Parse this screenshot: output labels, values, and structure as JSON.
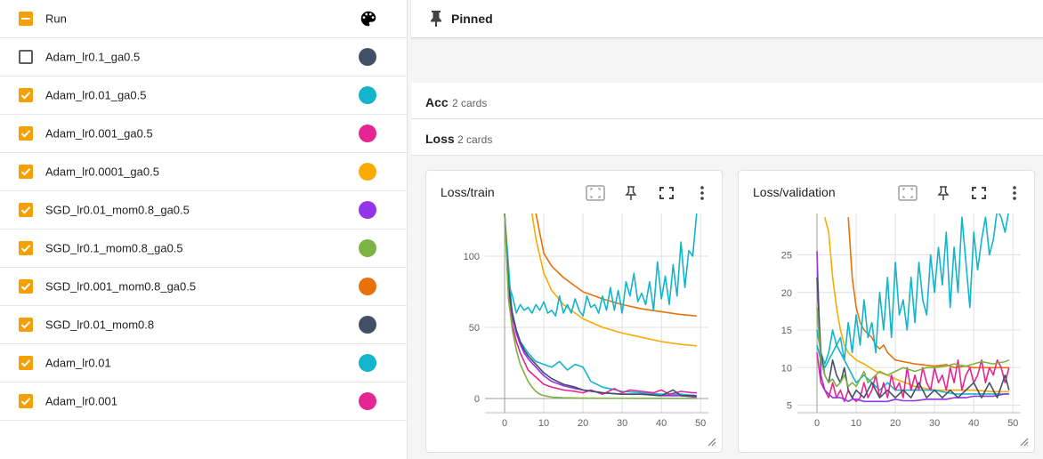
{
  "runs_header": {
    "label": "Run",
    "palette_icon": "palette-icon"
  },
  "runs": [
    {
      "name": "Adam_lr0.1_ga0.5",
      "checked": false,
      "color": "#425066"
    },
    {
      "name": "Adam_lr0.01_ga0.5",
      "checked": true,
      "color": "#12b5cb"
    },
    {
      "name": "Adam_lr0.001_ga0.5",
      "checked": true,
      "color": "#e52592"
    },
    {
      "name": "Adam_lr0.0001_ga0.5",
      "checked": true,
      "color": "#f9ab00"
    },
    {
      "name": "SGD_lr0.01_mom0.8_ga0.5",
      "checked": true,
      "color": "#9334e6"
    },
    {
      "name": "SGD_lr0.1_mom0.8_ga0.5",
      "checked": true,
      "color": "#7cb342"
    },
    {
      "name": "SGD_lr0.001_mom0.8_ga0.5",
      "checked": true,
      "color": "#e8710a"
    },
    {
      "name": "SGD_lr0.01_mom0.8",
      "checked": true,
      "color": "#425066"
    },
    {
      "name": "Adam_lr0.01",
      "checked": true,
      "color": "#12b5cb"
    },
    {
      "name": "Adam_lr0.001",
      "checked": true,
      "color": "#e52592"
    }
  ],
  "pinned": {
    "label": "Pinned",
    "icon": "pin-icon"
  },
  "groups": [
    {
      "title": "Acc",
      "count": "2 cards"
    },
    {
      "title": "Loss",
      "count": "2 cards"
    }
  ],
  "cards": {
    "train": {
      "title": "Loss/train"
    },
    "validation": {
      "title": "Loss/validation"
    }
  },
  "card_buttons": [
    "fit-domain-icon",
    "pin-icon",
    "fullscreen-icon",
    "more-vert-icon"
  ],
  "chart_data": [
    {
      "type": "line",
      "title": "Loss/train",
      "xlabel": "",
      "ylabel": "",
      "xlim": [
        -5,
        52
      ],
      "ylim": [
        -10,
        130
      ],
      "x_ticks": [
        0,
        10,
        20,
        30,
        40,
        50
      ],
      "y_ticks": [
        0,
        50,
        100
      ],
      "grid": true,
      "series": [
        {
          "color": "#e8710a",
          "x": [
            8,
            10,
            12,
            15,
            18,
            20,
            25,
            30,
            35,
            40,
            45,
            49
          ],
          "y": [
            130,
            102,
            93,
            85,
            79,
            75,
            70,
            66,
            63,
            61,
            59,
            58
          ]
        },
        {
          "color": "#f9ab00",
          "x": [
            7,
            8,
            10,
            12,
            15,
            18,
            20,
            25,
            30,
            35,
            40,
            45,
            49
          ],
          "y": [
            130,
            112,
            88,
            76,
            66,
            60,
            56,
            50,
            46,
            43,
            40,
            38,
            37
          ]
        },
        {
          "color": "#12b5cb",
          "x": [
            0,
            1,
            2,
            3,
            4,
            5,
            6,
            7,
            8,
            9,
            10,
            11,
            12,
            13,
            14,
            15,
            16,
            17,
            18,
            19,
            20,
            21,
            22,
            23,
            24,
            25,
            26,
            27,
            28,
            29,
            30,
            31,
            32,
            33,
            34,
            35,
            36,
            37,
            38,
            39,
            40,
            41,
            42,
            43,
            44,
            45,
            46,
            47,
            48,
            49
          ],
          "y": [
            130,
            80,
            72,
            60,
            66,
            62,
            64,
            60,
            66,
            62,
            68,
            60,
            62,
            58,
            72,
            60,
            66,
            60,
            70,
            62,
            58,
            72,
            64,
            66,
            60,
            72,
            62,
            78,
            62,
            76,
            60,
            82,
            72,
            88,
            68,
            74,
            66,
            82,
            62,
            96,
            70,
            86,
            66,
            94,
            72,
            110,
            78,
            104,
            100,
            130
          ]
        },
        {
          "color": "#12b5cb",
          "x": [
            0,
            2,
            4,
            6,
            8,
            10,
            12,
            14,
            16,
            18,
            20,
            22,
            25,
            30,
            35,
            40,
            45,
            49
          ],
          "y": [
            130,
            56,
            40,
            32,
            26,
            24,
            22,
            26,
            20,
            24,
            22,
            12,
            8,
            5,
            4,
            3,
            3,
            2
          ]
        },
        {
          "color": "#e52592",
          "x": [
            0,
            1,
            2,
            3,
            4,
            5,
            6,
            8,
            10,
            12,
            15,
            18,
            20,
            22,
            25,
            28,
            30,
            32,
            35,
            38,
            40,
            42,
            45,
            48,
            49
          ],
          "y": [
            130,
            75,
            52,
            40,
            32,
            26,
            20,
            15,
            10,
            8,
            6,
            5,
            4,
            6,
            3,
            7,
            4,
            6,
            5,
            4,
            6,
            3,
            5,
            4,
            4
          ]
        },
        {
          "color": "#9334e6",
          "x": [
            0,
            1,
            2,
            3,
            4,
            5,
            6,
            8,
            10,
            12,
            15,
            18,
            20,
            25,
            30,
            35,
            40,
            45,
            49
          ],
          "y": [
            130,
            80,
            58,
            46,
            38,
            32,
            28,
            22,
            16,
            12,
            9,
            7,
            6,
            4,
            3,
            3,
            2,
            2,
            1
          ]
        },
        {
          "color": "#425066",
          "x": [
            0,
            1,
            2,
            3,
            4,
            5,
            6,
            8,
            10,
            12,
            15,
            18,
            20,
            25,
            30,
            35,
            40,
            43,
            45,
            49
          ],
          "y": [
            130,
            78,
            60,
            48,
            40,
            34,
            30,
            24,
            18,
            14,
            10,
            8,
            6,
            4,
            3,
            3,
            2,
            6,
            2,
            2
          ]
        },
        {
          "color": "#7cb342",
          "x": [
            0,
            1,
            2,
            3,
            4,
            5,
            6,
            7,
            8,
            9,
            10,
            12,
            15,
            20,
            25,
            30,
            35,
            40,
            45,
            49
          ],
          "y": [
            130,
            70,
            48,
            34,
            24,
            18,
            12,
            8,
            5,
            3,
            2,
            1,
            0.5,
            0.3,
            0.2,
            0.2,
            0.1,
            0.1,
            0.1,
            0.1
          ]
        }
      ]
    },
    {
      "type": "line",
      "title": "Loss/validation",
      "xlabel": "",
      "ylabel": "",
      "xlim": [
        -5,
        52
      ],
      "ylim": [
        4,
        30.5
      ],
      "x_ticks": [
        0,
        10,
        20,
        30,
        40,
        50
      ],
      "y_ticks": [
        5,
        10,
        15,
        20,
        25
      ],
      "grid": true,
      "series": [
        {
          "color": "#e8710a",
          "x": [
            8,
            9,
            10,
            11,
            12,
            13,
            14,
            15,
            16,
            17,
            18,
            19,
            20,
            22,
            25,
            28,
            30,
            33,
            35,
            38,
            40,
            45,
            49
          ],
          "y": [
            30,
            22,
            18,
            16,
            15,
            14.5,
            14,
            13,
            12.5,
            13,
            12,
            11.5,
            11,
            10.8,
            10.5,
            10.3,
            10.2,
            10.4,
            10,
            10.2,
            10,
            10,
            10
          ]
        },
        {
          "color": "#f9ab00",
          "x": [
            2,
            3,
            4,
            5,
            6,
            7,
            8,
            9,
            10,
            12,
            15,
            18,
            20,
            25,
            30,
            35,
            40,
            45,
            49
          ],
          "y": [
            30,
            28,
            22,
            18,
            15,
            13,
            12,
            11.5,
            11,
            10.5,
            9.5,
            9,
            8.5,
            7.5,
            7,
            7,
            7,
            6.8,
            6.8
          ]
        },
        {
          "color": "#12b5cb",
          "x": [
            0,
            1,
            2,
            3,
            4,
            5,
            6,
            7,
            8,
            9,
            10,
            11,
            12,
            13,
            14,
            15,
            16,
            17,
            18,
            19,
            20,
            21,
            22,
            23,
            24,
            25,
            26,
            27,
            28,
            29,
            30,
            31,
            32,
            33,
            34,
            35,
            36,
            37,
            38,
            39,
            40,
            41,
            42,
            43,
            44,
            45,
            46,
            47,
            48,
            49
          ],
          "y": [
            15,
            12,
            10.5,
            12,
            15,
            13,
            14,
            11,
            16,
            12,
            17,
            13,
            19,
            14,
            16,
            12,
            20,
            15,
            22,
            14,
            24,
            17,
            19,
            15,
            22,
            16,
            24,
            19,
            17,
            25,
            20,
            26,
            21,
            28,
            18,
            26,
            20,
            30,
            24,
            18,
            28,
            23,
            27,
            30,
            25,
            27,
            31,
            30,
            28,
            31
          ]
        },
        {
          "color": "#12b5cb",
          "x": [
            0,
            1,
            2,
            3,
            4,
            5,
            6,
            7,
            8,
            9,
            10,
            12,
            14,
            16,
            18,
            20,
            25,
            30,
            35,
            40,
            45,
            49
          ],
          "y": [
            13,
            11,
            10,
            11,
            12,
            13,
            12,
            11,
            10,
            9,
            8,
            9,
            8,
            7,
            8,
            7,
            7,
            7,
            6.5,
            6.5,
            6.5,
            6.5
          ]
        },
        {
          "color": "#e52592",
          "x": [
            0,
            1,
            2,
            3,
            4,
            5,
            6,
            7,
            8,
            9,
            10,
            11,
            12,
            13,
            14,
            15,
            16,
            17,
            18,
            19,
            20,
            21,
            22,
            23,
            24,
            25,
            26,
            27,
            28,
            29,
            30,
            31,
            32,
            33,
            34,
            35,
            36,
            37,
            38,
            39,
            40,
            41,
            42,
            43,
            44,
            45,
            46,
            47,
            48,
            49
          ],
          "y": [
            12,
            8,
            7,
            6,
            8,
            6,
            7,
            5.5,
            7,
            6,
            5.5,
            6,
            8,
            6,
            7,
            9,
            6,
            8,
            6,
            9,
            7,
            8,
            6,
            10,
            7,
            9,
            7,
            10,
            8,
            7,
            10,
            8,
            9,
            7,
            10,
            8,
            11,
            7,
            9,
            10,
            8,
            9,
            11,
            8,
            10,
            9,
            11,
            10,
            8,
            10
          ]
        },
        {
          "color": "#9334e6",
          "x": [
            0,
            1,
            2,
            3,
            4,
            5,
            6,
            7,
            8,
            9,
            10,
            12,
            15,
            18,
            20,
            22,
            25,
            28,
            30,
            33,
            35,
            38,
            40,
            42,
            45,
            48,
            49
          ],
          "y": [
            25.5,
            9,
            7,
            6.5,
            6,
            6,
            6,
            5.8,
            5.5,
            5.8,
            5.8,
            5.5,
            5.5,
            5.5,
            5.8,
            5.6,
            5.6,
            5.8,
            5.8,
            5.8,
            6,
            6,
            6.2,
            6.2,
            6.2,
            6.5,
            6.5
          ]
        },
        {
          "color": "#425066",
          "x": [
            0,
            1,
            2,
            3,
            4,
            5,
            6,
            7,
            8,
            9,
            10,
            12,
            14,
            16,
            18,
            20,
            22,
            24,
            26,
            28,
            30,
            32,
            34,
            36,
            38,
            40,
            42,
            44,
            46,
            48,
            49
          ],
          "y": [
            22,
            12,
            9,
            8,
            11,
            9,
            8,
            10,
            7,
            6,
            7,
            6,
            8,
            6,
            7,
            6,
            7,
            6,
            8,
            6,
            7,
            6,
            7,
            6,
            7,
            8,
            6,
            8,
            6,
            9,
            7
          ]
        },
        {
          "color": "#7cb342",
          "x": [
            0,
            1,
            2,
            3,
            4,
            5,
            6,
            7,
            8,
            9,
            10,
            11,
            12,
            13,
            14,
            15,
            16,
            18,
            20,
            22,
            25,
            28,
            30,
            33,
            35,
            38,
            40,
            42,
            45,
            48,
            49
          ],
          "y": [
            18,
            11,
            9,
            8,
            8.5,
            7.5,
            8,
            9,
            7.5,
            8,
            7.5,
            8.5,
            9.5,
            8,
            8.5,
            9,
            9.5,
            9,
            9.5,
            10,
            9.5,
            10,
            10,
            10.2,
            10.5,
            10.2,
            10.5,
            10.8,
            10.5,
            10.8,
            11
          ]
        }
      ]
    }
  ]
}
